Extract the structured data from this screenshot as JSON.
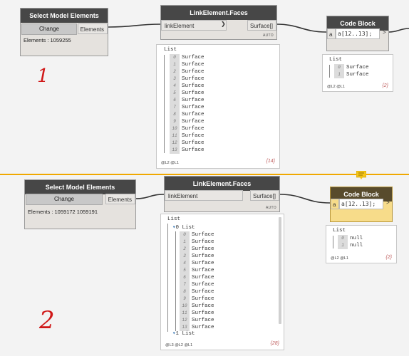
{
  "upper": {
    "select_node": {
      "title": "Select Model Elements",
      "change_label": "Change",
      "port_out": "Elements",
      "elements_text": "Elements : 1059255"
    },
    "faces_node": {
      "title": "LinkElement.Faces",
      "port_in": "linkElement",
      "port_out": "Surface[]",
      "auto_label": "AUTO"
    },
    "code_node": {
      "title": "Code Block",
      "port_in": "a",
      "code": "a[12..13];",
      "out_arrow": ">"
    },
    "faces_preview": {
      "title": "List",
      "items": [
        {
          "idx": "0",
          "val": "Surface"
        },
        {
          "idx": "1",
          "val": "Surface"
        },
        {
          "idx": "2",
          "val": "Surface"
        },
        {
          "idx": "3",
          "val": "Surface"
        },
        {
          "idx": "4",
          "val": "Surface"
        },
        {
          "idx": "5",
          "val": "Surface"
        },
        {
          "idx": "6",
          "val": "Surface"
        },
        {
          "idx": "7",
          "val": "Surface"
        },
        {
          "idx": "8",
          "val": "Surface"
        },
        {
          "idx": "9",
          "val": "Surface"
        },
        {
          "idx": "10",
          "val": "Surface"
        },
        {
          "idx": "11",
          "val": "Surface"
        },
        {
          "idx": "12",
          "val": "Surface"
        },
        {
          "idx": "13",
          "val": "Surface"
        }
      ],
      "levels": "@L2 @L1",
      "count": "{14}"
    },
    "code_preview": {
      "title": "List",
      "items": [
        {
          "idx": "0",
          "val": "Surface"
        },
        {
          "idx": "1",
          "val": "Surface"
        }
      ],
      "levels": "@L2 @L1",
      "count": "{2}"
    },
    "hand_number": "1"
  },
  "lower": {
    "select_node": {
      "title": "Select Model Elements",
      "change_label": "Change",
      "port_out": "Elements",
      "elements_text": "Elements : 1059172 1059191"
    },
    "faces_node": {
      "title": "LinkElement.Faces",
      "port_in": "linkElement",
      "port_out": "Surface[]",
      "auto_label": "AUTO"
    },
    "code_node": {
      "title": "Code Block",
      "port_in": "a",
      "code": "a[12..13];",
      "out_arrow": ">"
    },
    "faces_preview": {
      "title": "List",
      "sub_title_0": "0 List",
      "items": [
        {
          "idx": "0",
          "val": "Surface"
        },
        {
          "idx": "1",
          "val": "Surface"
        },
        {
          "idx": "2",
          "val": "Surface"
        },
        {
          "idx": "3",
          "val": "Surface"
        },
        {
          "idx": "4",
          "val": "Surface"
        },
        {
          "idx": "5",
          "val": "Surface"
        },
        {
          "idx": "6",
          "val": "Surface"
        },
        {
          "idx": "7",
          "val": "Surface"
        },
        {
          "idx": "8",
          "val": "Surface"
        },
        {
          "idx": "9",
          "val": "Surface"
        },
        {
          "idx": "10",
          "val": "Surface"
        },
        {
          "idx": "11",
          "val": "Surface"
        },
        {
          "idx": "12",
          "val": "Surface"
        },
        {
          "idx": "13",
          "val": "Surface"
        }
      ],
      "sub_title_1": "1 List",
      "levels": "@L3 @L2 @L1",
      "count": "{28}"
    },
    "code_preview": {
      "title": "List",
      "items": [
        {
          "idx": "0",
          "val": "null"
        },
        {
          "idx": "1",
          "val": "null"
        }
      ],
      "levels": "@L2 @L1",
      "count": "{2}"
    },
    "hand_number": "2"
  },
  "colors": {
    "divider": "#f0a800",
    "code_highlight": "#f7dc8a",
    "hand_ink": "#d01818"
  }
}
